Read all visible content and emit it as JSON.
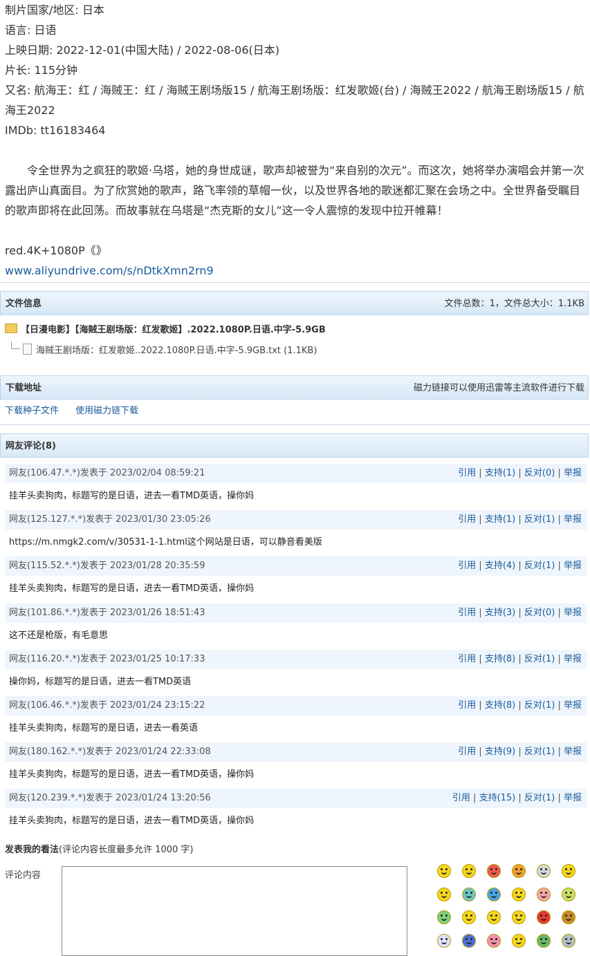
{
  "info": {
    "country": "制片国家/地区: 日本",
    "language": "语言: 日语",
    "release": "上映日期: 2022-12-01(中国大陆) / 2022-08-06(日本)",
    "runtime": "片长: 115分钟",
    "aka": "又名: 航海王：红 / 海贼王：红 / 海贼王剧场版15 / 航海王剧场版：红发歌姬(台) / 海贼王2022 / 航海王剧场版15 / 航海王2022",
    "imdb": "IMDb: tt16183464",
    "synopsis": "令全世界为之疯狂的歌姬·乌塔，她的身世成谜，歌声却被誉为“来自别的次元”。而这次，她将举办演唱会并第一次露出庐山真面目。为了欣赏她的歌声，路飞率领的草帽一伙，以及世界各地的歌迷都汇聚在会场之中。全世界备受瞩目的歌声即将在此回荡。而故事就在乌塔是“杰克斯的女儿”这一令人震惊的发现中拉开帷幕！",
    "quality": "red.4K+1080P《》",
    "link": "www.aliyundrive.com/s/nDtkXmn2rn9"
  },
  "file_info": {
    "title": "文件信息",
    "summary": "文件总数：1，文件总大小：1.1KB",
    "folder": "【日漫电影】【海贼王剧场版：红发歌姬】.2022.1080P.日语.中字-5.9GB",
    "file": "海贼王剧场版：红发歌姬..2022.1080P.日语.中字-5.9GB.txt  (1.1KB)"
  },
  "download": {
    "title": "下载地址",
    "hint": "磁力链接可以使用迅雷等主流软件进行下载",
    "torrent": "下载种子文件",
    "magnet": "使用磁力链下载"
  },
  "comments": {
    "title": "网友评论(8)",
    "items": [
      {
        "who": "网友(106.47.*.*)发表于 2023/02/04 08:59:21",
        "quote": "引用",
        "support": "支持(1)",
        "oppose": "反对(0)",
        "report": "举报",
        "body": "挂羊头卖狗肉，标题写的是日语，进去一看TMD英语，操你妈"
      },
      {
        "who": "网友(125.127.*.*)发表于 2023/01/30 23:05:26",
        "quote": "引用",
        "support": "支持(1)",
        "oppose": "反对(1)",
        "report": "举报",
        "body": "https://m.nmgk2.com/v/30531-1-1.html这个网站是日语，可以静音看美版"
      },
      {
        "who": "网友(115.52.*.*)发表于 2023/01/28 20:35:59",
        "quote": "引用",
        "support": "支持(4)",
        "oppose": "反对(1)",
        "report": "举报",
        "body": "挂羊头卖狗肉，标题写的是日语，进去一看TMD英语，操你妈"
      },
      {
        "who": "网友(101.86.*.*)发表于 2023/01/26 18:51:43",
        "quote": "引用",
        "support": "支持(3)",
        "oppose": "反对(0)",
        "report": "举报",
        "body": "这不还是枪版，有毛意思"
      },
      {
        "who": "网友(116.20.*.*)发表于 2023/01/25 10:17:33",
        "quote": "引用",
        "support": "支持(8)",
        "oppose": "反对(1)",
        "report": "举报",
        "body": "操你妈，标题写的是日语，进去一看TMD英语"
      },
      {
        "who": "网友(106.46.*.*)发表于 2023/01/24 23:15:22",
        "quote": "引用",
        "support": "支持(8)",
        "oppose": "反对(1)",
        "report": "举报",
        "body": "挂羊头卖狗肉，标题写的是日语，进去一看英语"
      },
      {
        "who": "网友(180.162.*.*)发表于 2023/01/24 22:33:08",
        "quote": "引用",
        "support": "支持(9)",
        "oppose": "反对(1)",
        "report": "举报",
        "body": "挂羊头卖狗肉，标题写的是日语，进去一看TMD英语，操你妈"
      },
      {
        "who": "网友(120.239.*.*)发表于 2023/01/24 13:20:56",
        "quote": "引用",
        "support": "支持(15)",
        "oppose": "反对(1)",
        "report": "举报",
        "body": "挂羊头卖狗肉，标题写的是日语，进去一看TMD英语，操你妈"
      }
    ]
  },
  "compose": {
    "title": "发表我的看法",
    "note": "(评论内容长度最多允许 1000 字)",
    "label": "评论内容"
  },
  "emoji_icons": [
    "smile-icon",
    "grin-icon",
    "cool-icon",
    "sunglasses-icon",
    "eyes-icon",
    "surprised-icon",
    "laugh-icon",
    "cry-icon",
    "sad-icon",
    "teeth-icon",
    "pig-icon",
    "sick-icon",
    "nauseous-icon",
    "confused-icon",
    "vomit-icon",
    "happy-icon",
    "angry-icon",
    "shy-icon",
    "devil-icon",
    "frown-icon",
    "kiss-icon",
    "wink-icon",
    "pirate-icon",
    "thinking-icon"
  ]
}
